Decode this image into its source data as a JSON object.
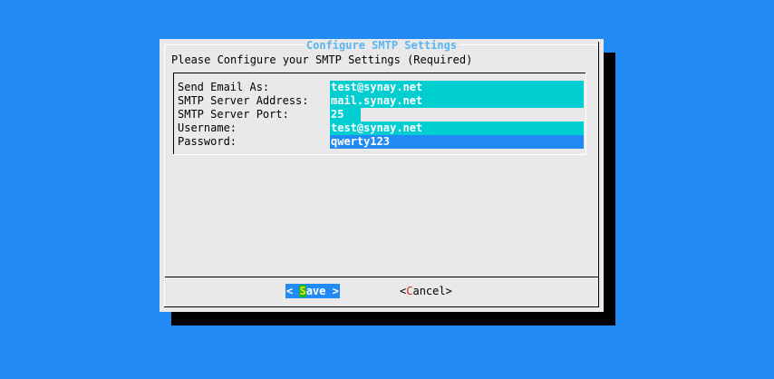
{
  "dialog": {
    "title": "Configure SMTP Settings",
    "prompt": "Please Configure your SMTP Settings (Required)"
  },
  "form": {
    "fields": [
      {
        "label": "Send Email As:",
        "value": "test@synay.net"
      },
      {
        "label": "SMTP Server Address:",
        "value": "mail.synay.net"
      },
      {
        "label": "SMTP Server Port:",
        "value": "25"
      },
      {
        "label": "Username:",
        "value": "test@synay.net"
      },
      {
        "label": "Password:",
        "value": "qwerty123"
      }
    ]
  },
  "buttons": {
    "save": {
      "open": "< ",
      "hotkey": "S",
      "rest": "ave",
      "close": " >"
    },
    "cancel": {
      "open": "<",
      "hotkey": "C",
      "rest": "ancel",
      "close": ">"
    }
  },
  "colors": {
    "background": "#218af5",
    "dialog": "#e9e9e9",
    "title": "#5ab5f0",
    "field": "#00ced0",
    "active_field": "#218af5",
    "shadow": "#000000"
  }
}
